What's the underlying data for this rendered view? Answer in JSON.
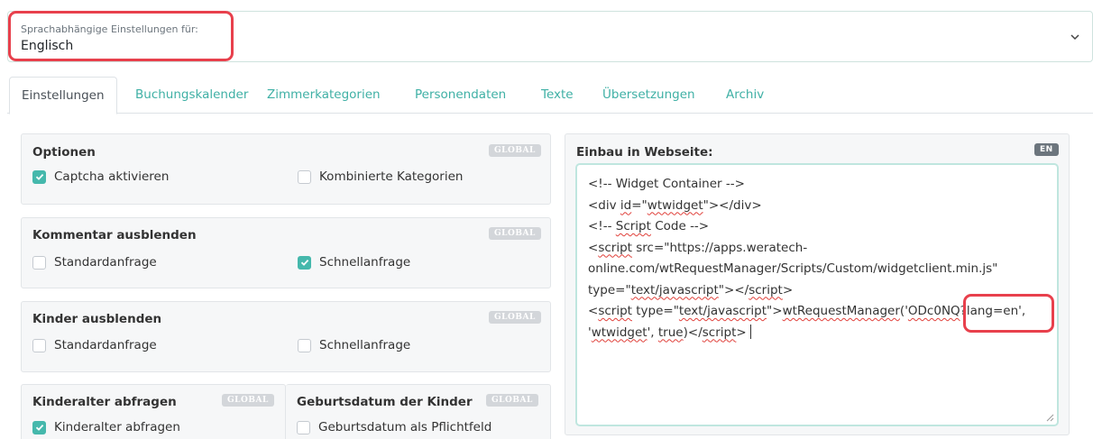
{
  "language_select": {
    "label": "Sprachabhängige Einstellungen für:",
    "value": "Englisch"
  },
  "tabs": [
    {
      "label": "Einstellungen",
      "active": true
    },
    {
      "label": "Buchungskalender"
    },
    {
      "label": "Zimmerkategorien"
    },
    {
      "label": "Personendaten"
    },
    {
      "label": "Texte"
    },
    {
      "label": "Übersetzungen"
    },
    {
      "label": "Archiv"
    }
  ],
  "panels": {
    "optionen": {
      "title": "Optionen",
      "badge": "GLOBAL",
      "options": [
        {
          "label": "Captcha aktivieren",
          "checked": true
        },
        {
          "label": "Kombinierte Kategorien",
          "checked": false
        }
      ]
    },
    "kommentar": {
      "title": "Kommentar ausblenden",
      "badge": "GLOBAL",
      "options": [
        {
          "label": "Standardanfrage",
          "checked": false
        },
        {
          "label": "Schnellanfrage",
          "checked": true
        }
      ]
    },
    "kinder": {
      "title": "Kinder ausblenden",
      "badge": "GLOBAL",
      "options": [
        {
          "label": "Standardanfrage",
          "checked": false
        },
        {
          "label": "Schnellanfrage",
          "checked": false
        }
      ]
    },
    "kinderalter": {
      "title": "Kinderalter abfragen",
      "badge": "GLOBAL",
      "options": [
        {
          "label": "Kinderalter abfragen",
          "checked": true
        }
      ]
    },
    "geburtsdatum": {
      "title": "Geburtsdatum der Kinder",
      "badge": "GLOBAL",
      "options": [
        {
          "label": "Geburtsdatum als Pflichtfeld",
          "checked": false
        }
      ]
    },
    "einbau": {
      "title": "Einbau in Webseite:",
      "badge": "EN",
      "code": {
        "l1": "<!-- Widget Container -->",
        "l2a": "<div ",
        "l2b": "id",
        "l2c": "=\"",
        "l2d": "wtwidget",
        "l2e": "\"></div>",
        "l3a": "<!-- ",
        "l3b": "Script",
        "l3c": " Code -->",
        "l4a": "<",
        "l4b": "script",
        "l4c": " src=\"https://apps.weratech-",
        "l5": "online.com/wtRequestManager/Scripts/Custom/widgetclient.min.js\"",
        "l6a": "type=\"",
        "l6b": "text/javascript",
        "l6c": "\"></",
        "l6d": "script",
        "l6e": ">",
        "l7a": "<",
        "l7b": "script",
        "l7c": " type=\"",
        "l7d": "text/javascript",
        "l7e": "\">",
        "l7f": "wtRequestManager",
        "l7g": "('",
        "l7h": "ODc0NQ",
        "l7i": "?lang=en',",
        "l8a": "'",
        "l8b": "wtwidget",
        "l8c": "', ",
        "l8d": "true",
        "l8e": ")</",
        "l8f": "script",
        "l8g": ">"
      }
    }
  },
  "colors": {
    "accent": "#45b8ac",
    "tab_link": "#3fb0a5",
    "highlight": "#e8404c",
    "badge_global": "#d3d6da",
    "badge_en": "#6c757d"
  }
}
